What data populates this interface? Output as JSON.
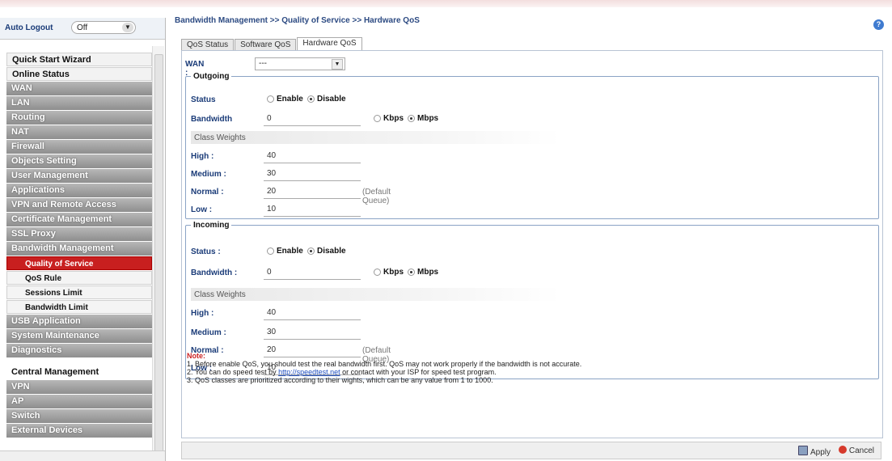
{
  "sidebar": {
    "auto_logout_label": "Auto Logout",
    "auto_logout_value": "Off",
    "items": [
      {
        "label": "Quick Start Wizard",
        "style": "top"
      },
      {
        "label": "Online Status",
        "style": "top"
      },
      {
        "label": "WAN",
        "style": "grey"
      },
      {
        "label": "LAN",
        "style": "grey"
      },
      {
        "label": "Routing",
        "style": "grey"
      },
      {
        "label": "NAT",
        "style": "grey"
      },
      {
        "label": "Firewall",
        "style": "grey"
      },
      {
        "label": "Objects Setting",
        "style": "grey"
      },
      {
        "label": "User Management",
        "style": "grey"
      },
      {
        "label": "Applications",
        "style": "grey"
      },
      {
        "label": "VPN and Remote Access",
        "style": "grey"
      },
      {
        "label": "Certificate Management",
        "style": "grey"
      },
      {
        "label": "SSL Proxy",
        "style": "grey"
      },
      {
        "label": "Bandwidth Management",
        "style": "grey"
      },
      {
        "label": "Quality of Service",
        "style": "sub active"
      },
      {
        "label": "QoS Rule",
        "style": "sub"
      },
      {
        "label": "Sessions Limit",
        "style": "sub"
      },
      {
        "label": "Bandwidth Limit",
        "style": "sub"
      },
      {
        "label": "USB Application",
        "style": "grey"
      },
      {
        "label": "System Maintenance",
        "style": "grey"
      },
      {
        "label": "Diagnostics",
        "style": "grey"
      },
      {
        "label": "Central Management",
        "style": "section"
      },
      {
        "label": "VPN",
        "style": "grey"
      },
      {
        "label": "AP",
        "style": "grey"
      },
      {
        "label": "Switch",
        "style": "grey"
      },
      {
        "label": "External Devices",
        "style": "grey"
      }
    ]
  },
  "breadcrumb": "Bandwidth Management >> Quality of Service >> Hardware QoS",
  "tabs": [
    "QoS Status",
    "Software QoS",
    "Hardware QoS"
  ],
  "wan": {
    "label": "WAN :",
    "value": "---"
  },
  "outgoing": {
    "legend": "Outgoing",
    "status_label": "Status",
    "enable": "Enable",
    "disable": "Disable",
    "bandwidth_label": "Bandwidth",
    "bandwidth_value": "0",
    "kbps": "Kbps",
    "mbps": "Mbps",
    "class_weights": "Class Weights",
    "high_label": "High :",
    "high": "40",
    "medium_label": "Medium :",
    "medium": "30",
    "normal_label": "Normal :",
    "normal": "20",
    "low_label": "Low :",
    "low": "10",
    "default_queue": "(Default Queue)"
  },
  "incoming": {
    "legend": "Incoming",
    "status_label": "Status :",
    "enable": "Enable",
    "disable": "Disable",
    "bandwidth_label": "Bandwidth :",
    "bandwidth_value": "0",
    "kbps": "Kbps",
    "mbps": "Mbps",
    "class_weights": "Class Weights",
    "high_label": "High :",
    "high": "40",
    "medium_label": "Medium :",
    "medium": "30",
    "normal_label": "Normal :",
    "normal": "20",
    "low_label": "Low :",
    "low": "10",
    "default_queue": "(Default Queue)"
  },
  "note": {
    "title": "Note:",
    "n1": "1. Before enable QoS, you should test the real bandwidth first. QoS may not work properly if the bandwidth is not accurate.",
    "n2_pre": "2. You can do speed test by ",
    "n2_link": "http://speedtest.net",
    "n2_post": " or contact with your ISP for speed test program.",
    "n3": "3. QoS classes are prioritized according to their wights, which can be any value from 1 to 1000."
  },
  "footer": {
    "apply": "Apply",
    "cancel": "Cancel"
  }
}
